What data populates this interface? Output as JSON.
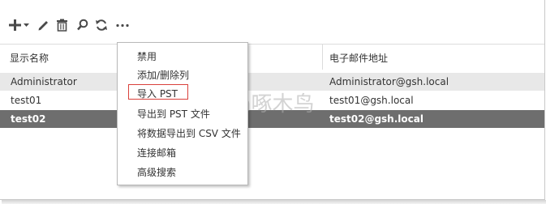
{
  "toolbar": {
    "icons": [
      "add-icon",
      "dropdown-caret-icon",
      "edit-icon",
      "delete-icon",
      "search-icon",
      "refresh-icon",
      "more-icon"
    ]
  },
  "table": {
    "columns": [
      "显示名称",
      "电子邮件地址"
    ],
    "rows": [
      {
        "name": "Administrator",
        "email": "Administrator@gsh.local"
      },
      {
        "name": "test01",
        "email": "test01@gsh.local"
      },
      {
        "name": "test02",
        "email": "test02@gsh.local"
      }
    ]
  },
  "menu": {
    "items": [
      "禁用",
      "添加/删除列",
      "导入 PST",
      "导出到 PST 文件",
      "将数据导出到 CSV 文件",
      "连接邮箱",
      "高级搜索"
    ],
    "highlighted_item": "导入 PST"
  },
  "watermark": "gs_h啄木鸟",
  "colors": {
    "icon": "#4a4a4a",
    "selected_row_bg": "#6e6e6e",
    "hover_row_bg": "#e8e8e8",
    "highlight_border": "#d9413b"
  }
}
